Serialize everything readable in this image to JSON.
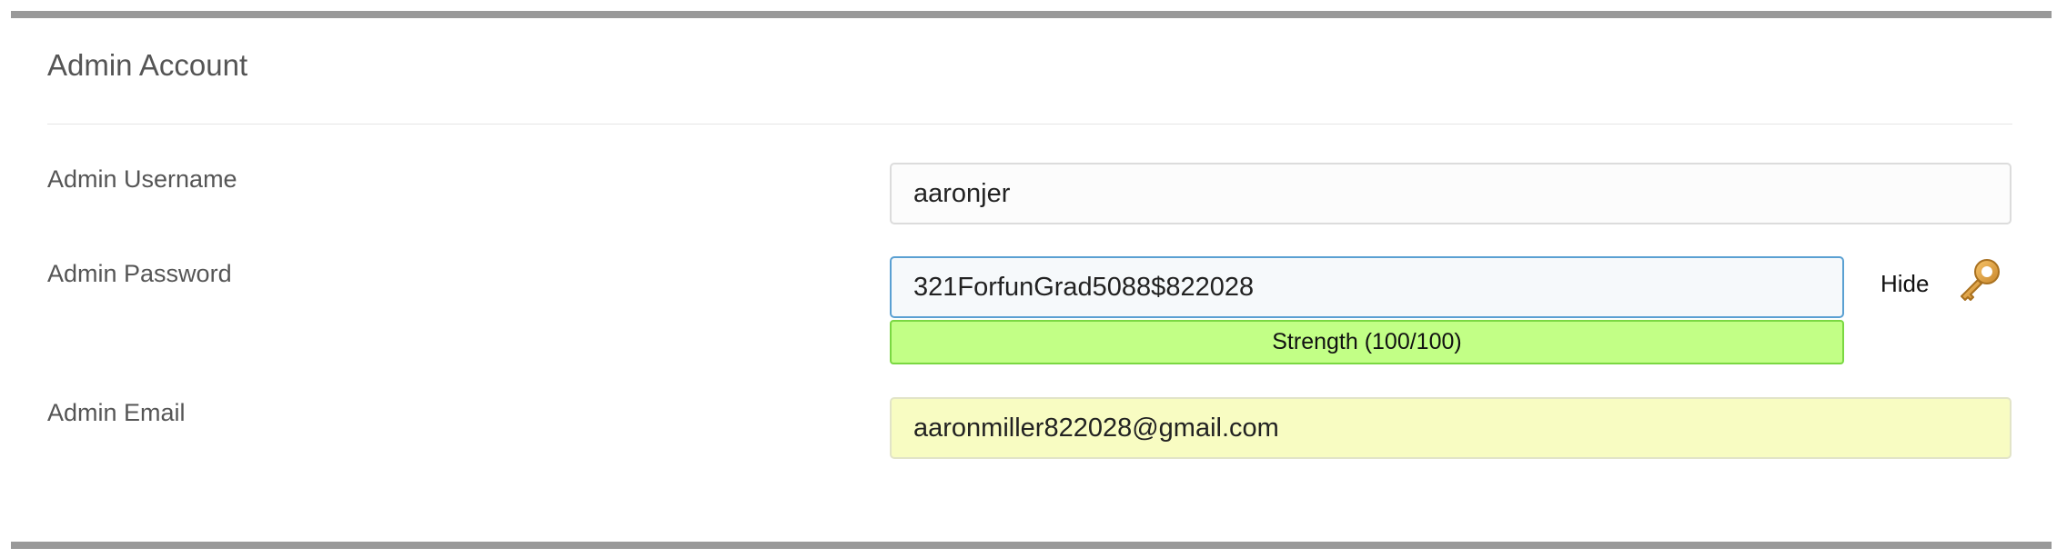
{
  "section": {
    "title": "Admin Account"
  },
  "fields": {
    "username": {
      "label": "Admin Username",
      "value": "aaronjer"
    },
    "password": {
      "label": "Admin Password",
      "value": "321ForfunGrad5088$822028",
      "strength_text": "Strength (100/100)",
      "strength_score": 100,
      "toggle_label": "Hide",
      "generate_icon": "key-icon"
    },
    "email": {
      "label": "Admin Email",
      "value": "aaronmiller822028@gmail.com"
    }
  },
  "colors": {
    "strength_strong": "#c2ff86",
    "autofill_bg": "#f8fcc2",
    "focus_border": "#5aa0d2"
  }
}
